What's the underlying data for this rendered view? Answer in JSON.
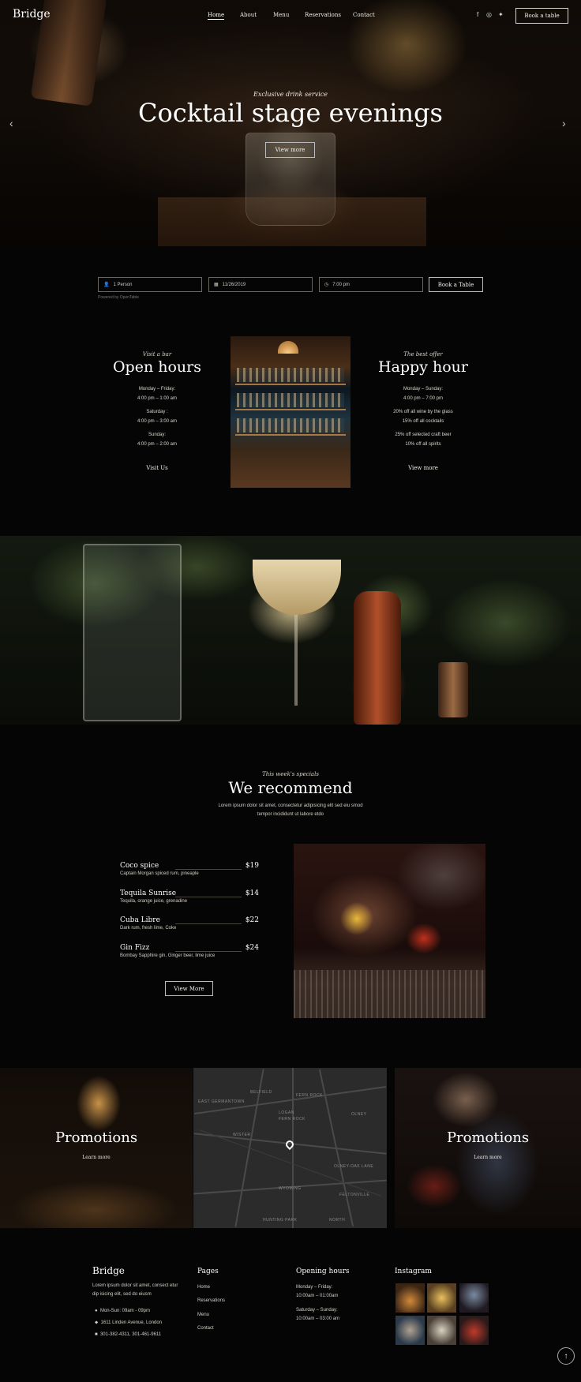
{
  "header": {
    "logo": "Bridge",
    "nav": [
      "Home",
      "About",
      "Menu",
      "Reservations",
      "Contact"
    ],
    "social_icons": [
      "facebook-icon",
      "instagram-icon",
      "twitter-icon"
    ],
    "book_button": "Book a table"
  },
  "hero": {
    "subtitle": "Exclusive drink service",
    "title": "Cocktail stage evenings",
    "button": "View more"
  },
  "booking": {
    "people": "1 Person",
    "date": "11/26/2019",
    "time": "7:00 pm",
    "button": "Book a Table",
    "powered": "Powered by OpenTable"
  },
  "open_hours": {
    "subtitle": "Visit a bar",
    "title": "Open hours",
    "lines": [
      "Monday – Friday:",
      "4:00 pm – 1:00 am",
      "Saturday :",
      "4:00 pm – 3:00 am",
      "Sunday:",
      "4:00 pm – 2:00 am"
    ],
    "link": "Visit Us"
  },
  "happy_hour": {
    "subtitle": "The best offer",
    "title": "Happy hour",
    "lines": [
      "Monday – Sunday:",
      "4:00 pm – 7:00 pm",
      "20% off all wine by the glass",
      "15% off all cocktails",
      "25% off selected craft beer",
      "10% off all spirits"
    ],
    "link": "View more"
  },
  "recommend": {
    "subtitle": "This week's specials",
    "title": "We recommend",
    "description": "Lorem ipsum dolor sit amet, consectetur adipisicing elit sed eiu smod tempor incididunt ut labore etdo",
    "items": [
      {
        "name": "Coco spice",
        "price": "$19",
        "desc": "Captain Morgan spiced rum, pineaple"
      },
      {
        "name": "Tequila Sunrise",
        "price": "$14",
        "desc": "Tequila, orange juice, grenadine"
      },
      {
        "name": "Cuba Libre",
        "price": "$22",
        "desc": "Dark rum, fresh lime, Coke"
      },
      {
        "name": "Gin Fizz",
        "price": "$24",
        "desc": "Bombay Sapphire gin, Ginger beer, lime juice"
      }
    ],
    "button": "View More"
  },
  "tiles": {
    "left": {
      "title": "Promotions",
      "link": "Learn more"
    },
    "right": {
      "title": "Promotions",
      "link": "Learn more"
    },
    "map_labels": [
      "BELFIELD",
      "FERN ROCK",
      "EAST GERMANTOWN",
      "LOGAN",
      "FERN ROCK",
      "OLNEY",
      "WISTER",
      "OLNEY-OAK LANE",
      "WYOMING",
      "FELTONVILLE",
      "HUNTING PARK",
      "NORTH"
    ]
  },
  "footer": {
    "logo": "Bridge",
    "about": [
      "Lorem ipsum dolor sit amet, consect etur",
      "dip isicing elit, sed do eiusm"
    ],
    "contact": [
      "Mon-Sun: 09am - 09pm",
      "1611 Linden Avenue, London",
      "301-382-4311, 301-461-9611"
    ],
    "pages_title": "Pages",
    "pages": [
      "Home",
      "Reservations",
      "Menu",
      "Contact"
    ],
    "hours_title": "Opening hours",
    "hours": [
      "Monday – Friday:",
      "10:00am – 01:00am",
      "Saturday – Sunday:",
      "10:00am – 03:00 am"
    ],
    "insta_title": "Instagram"
  },
  "colors": {
    "background": "#050505",
    "text": "#e8e3da",
    "border": "#6b6660"
  }
}
